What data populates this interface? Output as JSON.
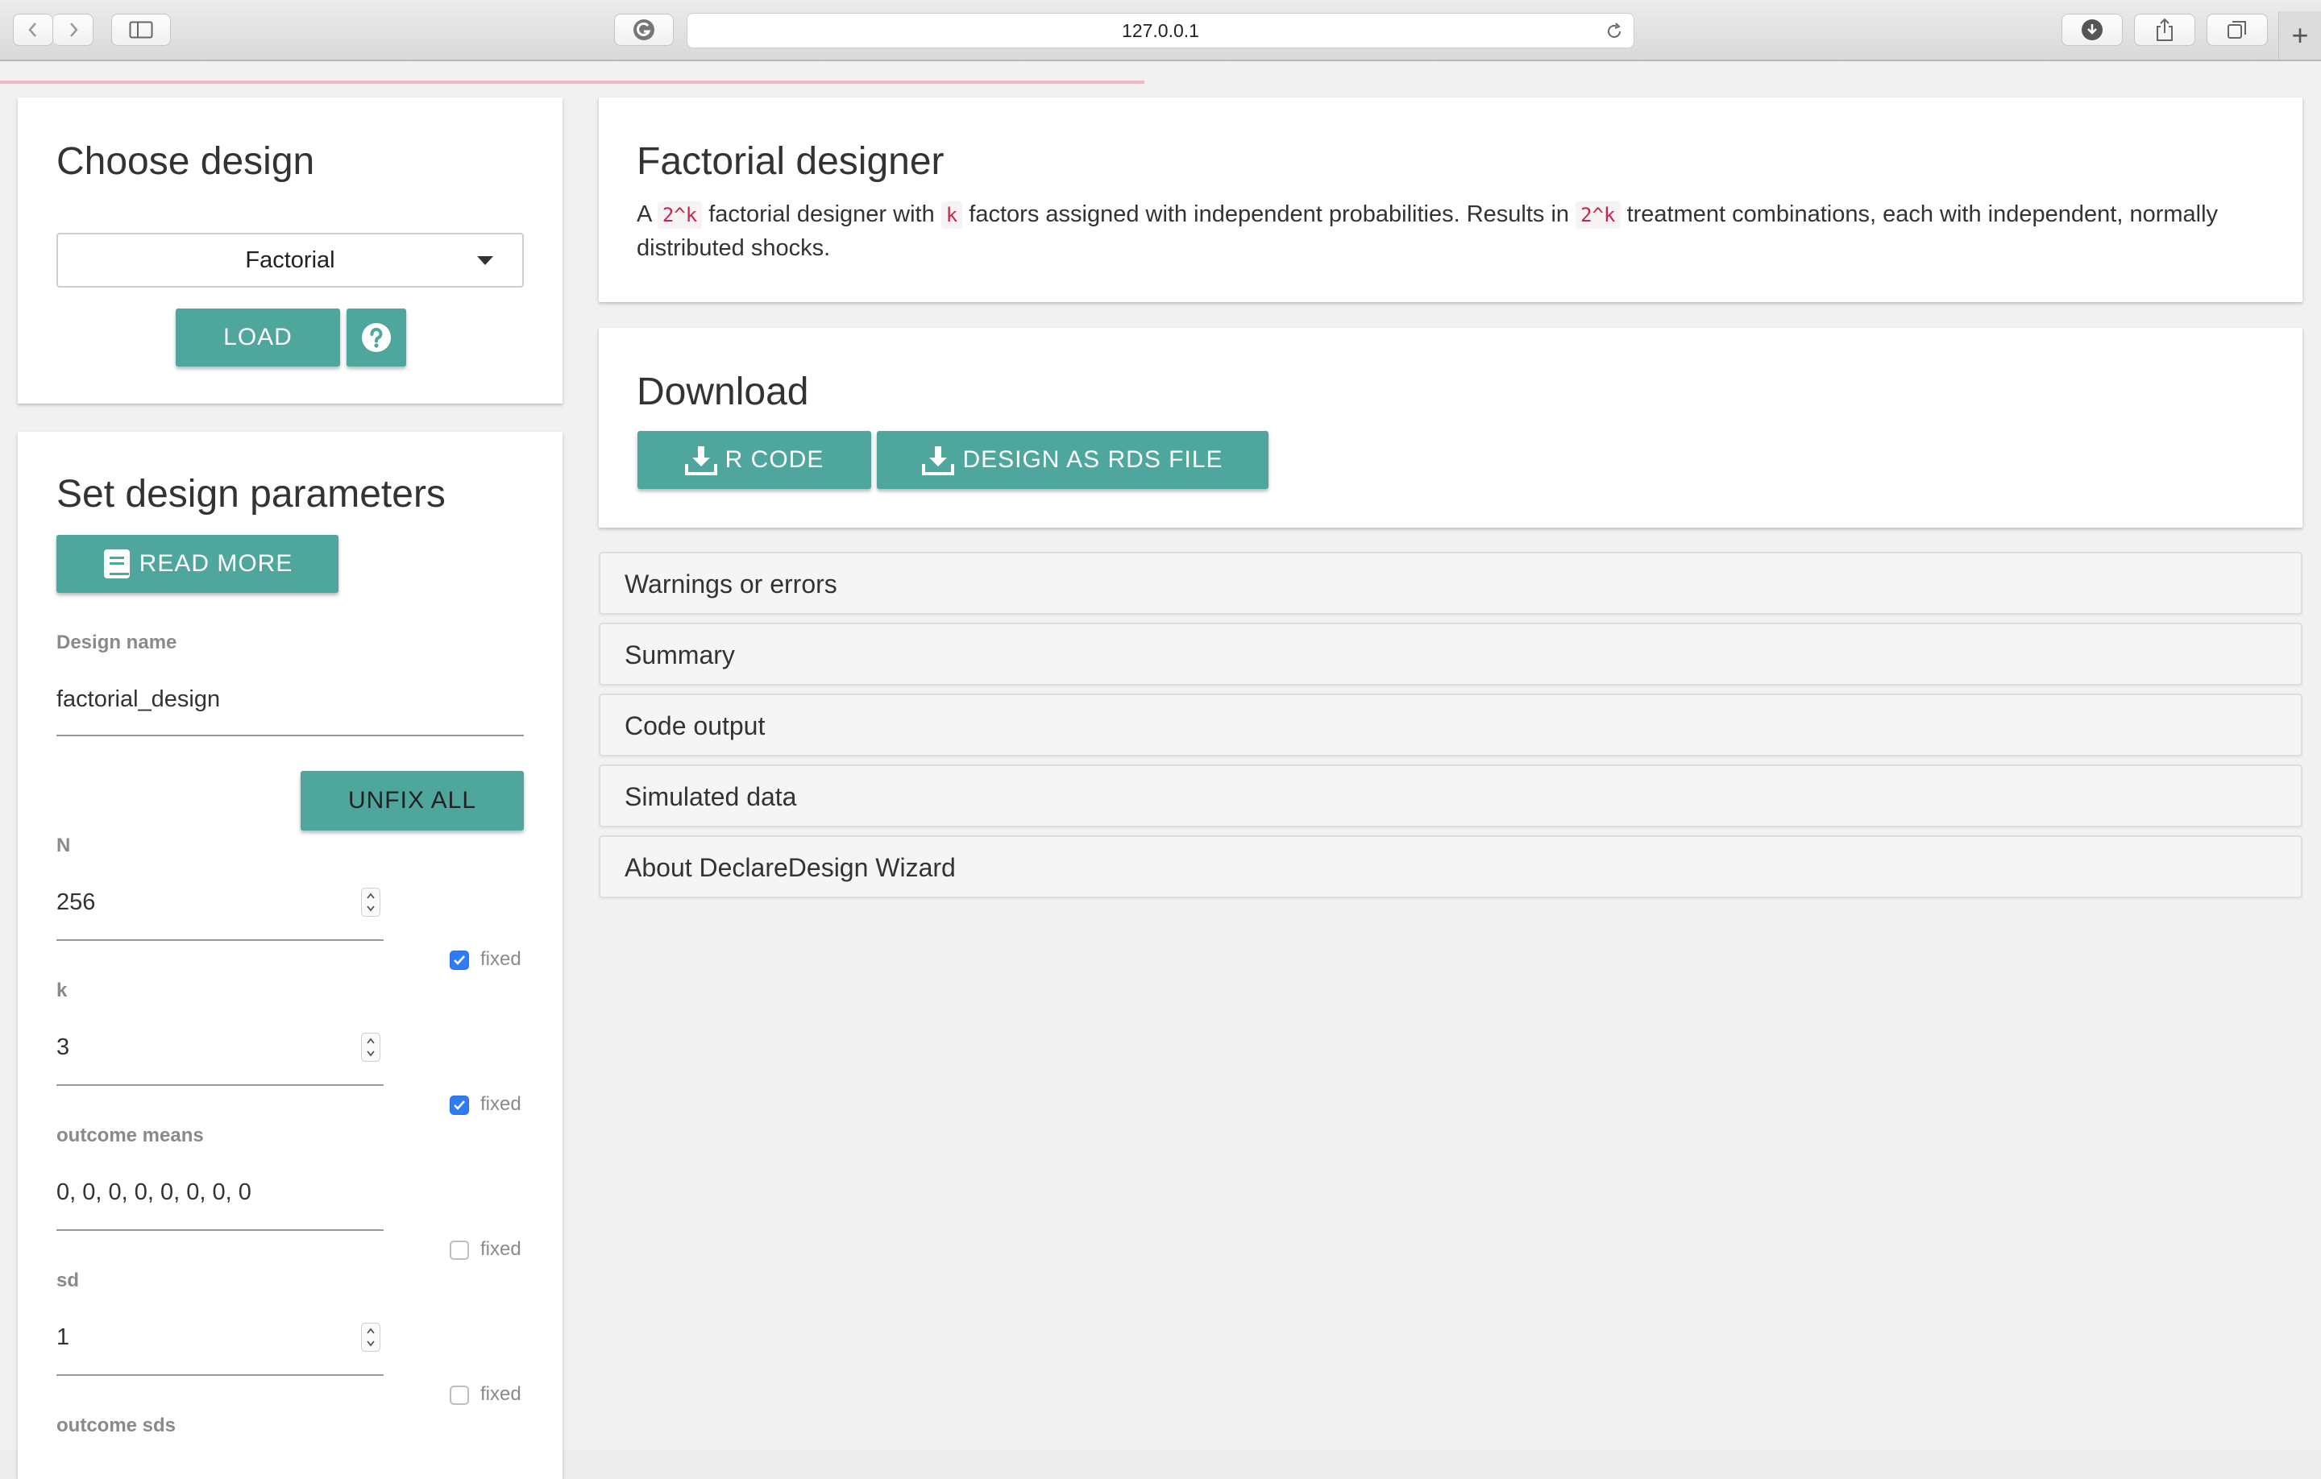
{
  "browser": {
    "url": "127.0.0.1"
  },
  "choose_design": {
    "title": "Choose design",
    "selected_design": "Factorial",
    "load_label": "LOAD"
  },
  "parameters": {
    "title": "Set design parameters",
    "read_more_label": "READ MORE",
    "design_name_label": "Design name",
    "design_name_value": "factorial_design",
    "unfix_all_label": "UNFIX ALL",
    "fixed_label": "fixed",
    "fields": [
      {
        "label": "N",
        "value": "256",
        "fixed": true
      },
      {
        "label": "k",
        "value": "3",
        "fixed": true
      },
      {
        "label": "outcome means",
        "value": "0, 0, 0, 0, 0, 0, 0, 0",
        "fixed": false
      },
      {
        "label": "sd",
        "value": "1",
        "fixed": false
      },
      {
        "label": "outcome sds",
        "value": "",
        "fixed": false
      }
    ]
  },
  "designer": {
    "title": "Factorial designer",
    "desc_1": "A",
    "code_2k": "2^k",
    "desc_2": "factorial designer with",
    "code_k": "k",
    "desc_3": "factors assigned with independent probabilities. Results in",
    "desc_4": "treatment combinations, each with independent, normally distributed shocks."
  },
  "download": {
    "title": "Download",
    "r_code_label": "R CODE",
    "rds_label": "DESIGN AS RDS FILE"
  },
  "panels": [
    "Warnings or errors",
    "Summary",
    "Code output",
    "Simulated data",
    "About DeclareDesign Wizard"
  ],
  "colors": {
    "accent": "#4ea69d",
    "checkbox": "#2f7bf5",
    "code_text": "#c7254e",
    "progress": "#f2b6be"
  }
}
